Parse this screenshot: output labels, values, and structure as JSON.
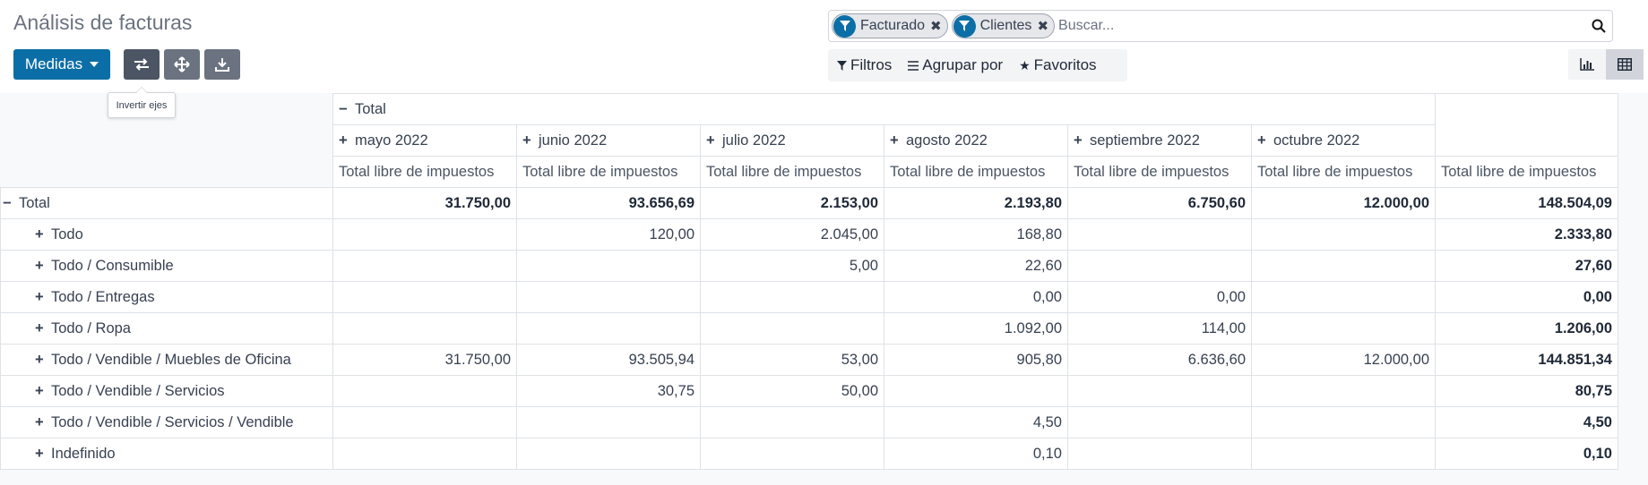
{
  "page": {
    "title": "Análisis de facturas"
  },
  "toolbar": {
    "measures_label": "Medidas",
    "tooltip": "Invertir ejes"
  },
  "search": {
    "facets": [
      {
        "label": "Facturado"
      },
      {
        "label": "Clientes"
      }
    ],
    "placeholder": "Buscar..."
  },
  "filters": {
    "filters_label": "Filtros",
    "group_label": "Agrupar por",
    "favorites_label": "Favoritos"
  },
  "pivot": {
    "col_total_label": "Total",
    "columns": [
      "mayo 2022",
      "junio 2022",
      "julio 2022",
      "agosto 2022",
      "septiembre 2022",
      "octubre 2022"
    ],
    "measure_label": "Total libre de impuestos",
    "total_row": {
      "label": "Total",
      "values": [
        "31.750,00",
        "93.656,69",
        "2.153,00",
        "2.193,80",
        "6.750,60",
        "12.000,00",
        "148.504,09"
      ]
    },
    "rows": [
      {
        "label": "Todo",
        "values": [
          "",
          "120,00",
          "2.045,00",
          "168,80",
          "",
          "",
          "2.333,80"
        ]
      },
      {
        "label": "Todo / Consumible",
        "values": [
          "",
          "",
          "5,00",
          "22,60",
          "",
          "",
          "27,60"
        ]
      },
      {
        "label": "Todo / Entregas",
        "values": [
          "",
          "",
          "",
          "0,00",
          "0,00",
          "",
          "0,00"
        ]
      },
      {
        "label": "Todo / Ropa",
        "values": [
          "",
          "",
          "",
          "1.092,00",
          "114,00",
          "",
          "1.206,00"
        ]
      },
      {
        "label": "Todo / Vendible / Muebles de Oficina",
        "values": [
          "31.750,00",
          "93.505,94",
          "53,00",
          "905,80",
          "6.636,60",
          "12.000,00",
          "144.851,34"
        ]
      },
      {
        "label": "Todo / Vendible / Servicios",
        "values": [
          "",
          "30,75",
          "50,00",
          "",
          "",
          "",
          "80,75"
        ]
      },
      {
        "label": "Todo / Vendible / Servicios / Vendible",
        "values": [
          "",
          "",
          "",
          "4,50",
          "",
          "",
          "4,50"
        ]
      },
      {
        "label": "Indefinido",
        "values": [
          "",
          "",
          "",
          "0,10",
          "",
          "",
          "0,10"
        ]
      }
    ]
  }
}
